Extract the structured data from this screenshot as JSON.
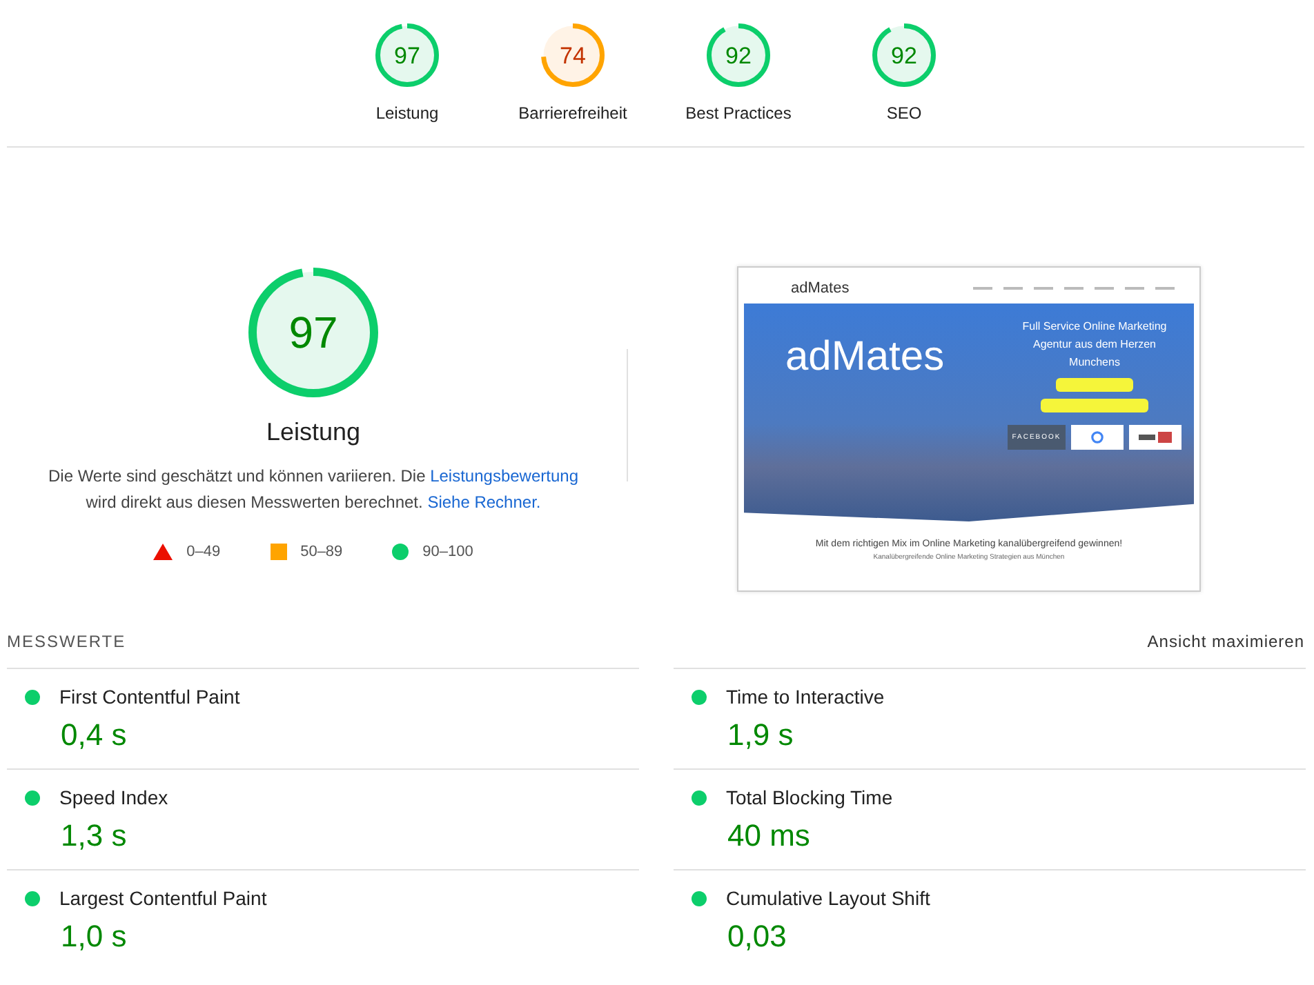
{
  "categories": [
    {
      "score": "97",
      "label": "Leistung",
      "level": 0.97,
      "kind": "pass"
    },
    {
      "score": "74",
      "label": "Barrierefreiheit",
      "level": 0.74,
      "kind": "average"
    },
    {
      "score": "92",
      "label": "Best Practices",
      "level": 0.92,
      "kind": "pass"
    },
    {
      "score": "92",
      "label": "SEO",
      "level": 0.92,
      "kind": "pass"
    }
  ],
  "performance": {
    "score": "97",
    "level": 0.97,
    "kind": "pass",
    "title": "Leistung",
    "description_before": "Die Werte sind geschätzt und können variieren. Die ",
    "description_link": "Leistungsbewertung",
    "description_middle": " wird direkt aus diesen Messwerten berechnet. ",
    "calculator_link": "Siehe Rechner."
  },
  "legend": [
    {
      "kind": "fail",
      "range": "0–49"
    },
    {
      "kind": "average",
      "range": "50–89"
    },
    {
      "kind": "pass",
      "range": "90–100"
    }
  ],
  "screenshot": {
    "logo": "adMates",
    "hero_logo": "adMates",
    "headline": "Full Service Online Marketing Agentur aus dem Herzen Munchens",
    "partner": "FACEBOOK",
    "tagline": "Mit dem richtigen Mix im Online Marketing kanalübergreifend gewinnen!",
    "subline": "Kanalübergreifende Online Marketing Strategien aus München"
  },
  "metrics_section": {
    "heading": "MESSWERTE",
    "toggle": "Ansicht maximieren"
  },
  "metrics": [
    {
      "name": "First Contentful Paint",
      "value": "0,4 s",
      "kind": "pass"
    },
    {
      "name": "Time to Interactive",
      "value": "1,9 s",
      "kind": "pass"
    },
    {
      "name": "Speed Index",
      "value": "1,3 s",
      "kind": "pass"
    },
    {
      "name": "Total Blocking Time",
      "value": "40 ms",
      "kind": "pass"
    },
    {
      "name": "Largest Contentful Paint",
      "value": "1,0 s",
      "kind": "pass"
    },
    {
      "name": "Cumulative Layout Shift",
      "value": "0,03",
      "kind": "pass"
    }
  ]
}
